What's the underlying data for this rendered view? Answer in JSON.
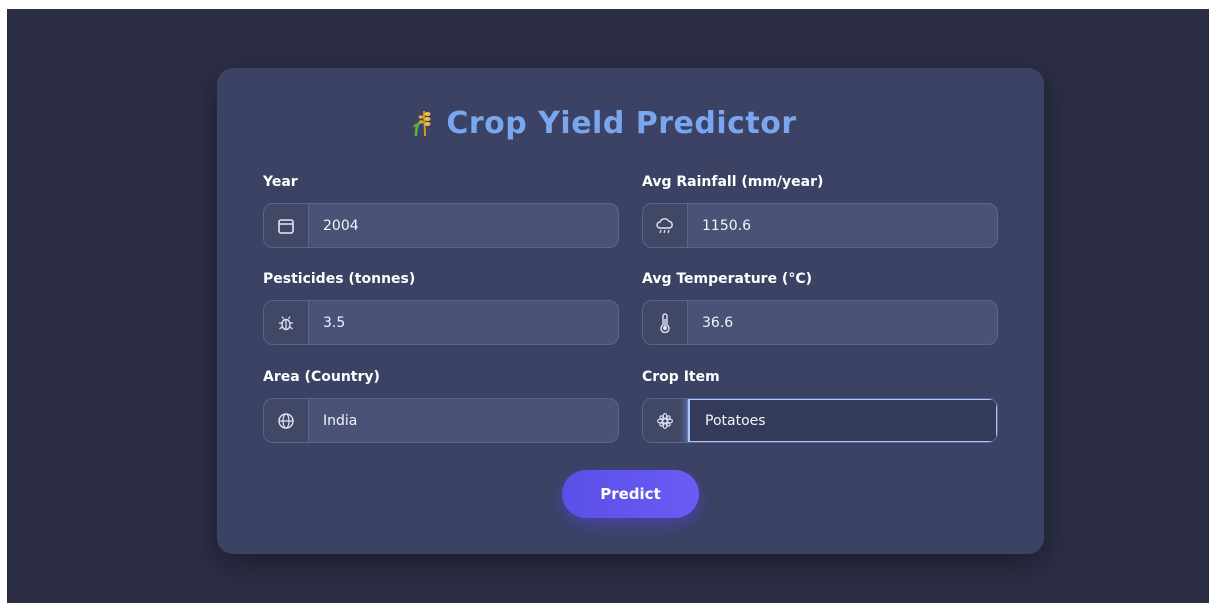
{
  "app": {
    "title": "Crop Yield Predictor",
    "colors": {
      "background": "#2b2e45",
      "card": "#3b4263",
      "title": "#7aa6f0",
      "button": "#5b4fe8"
    }
  },
  "form": {
    "year": {
      "label": "Year",
      "value": "2004",
      "icon": "calendar-icon"
    },
    "rainfall": {
      "label": "Avg Rainfall (mm/year)",
      "value": "1150.6",
      "icon": "rain-cloud-icon"
    },
    "pesticides": {
      "label": "Pesticides (tonnes)",
      "value": "3.5",
      "icon": "bug-icon"
    },
    "temperature": {
      "label": "Avg Temperature (°C)",
      "value": "36.6",
      "icon": "thermometer-icon"
    },
    "area": {
      "label": "Area (Country)",
      "value": "India",
      "icon": "globe-icon"
    },
    "crop": {
      "label": "Crop Item",
      "value": "Potatoes",
      "icon": "flower-icon"
    },
    "predict_label": "Predict"
  }
}
